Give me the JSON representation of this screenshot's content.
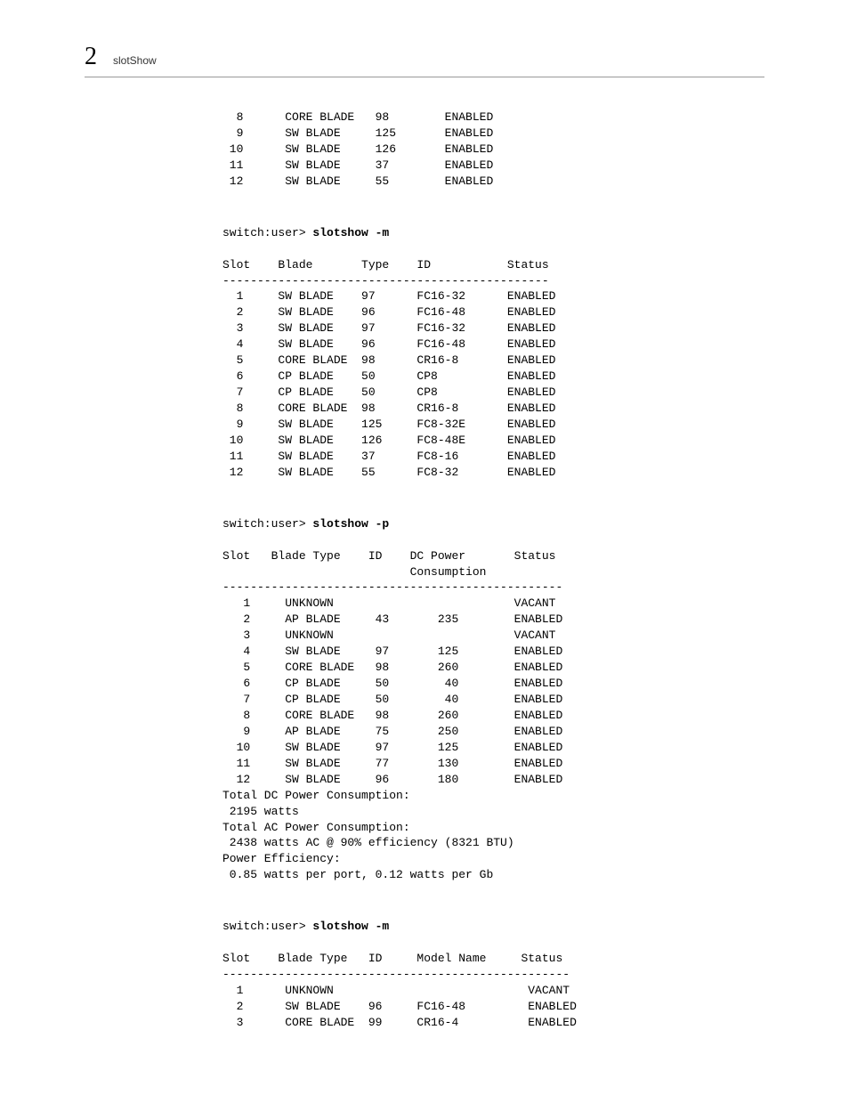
{
  "header": {
    "chapter_number": "2",
    "chapter_title": "slotShow"
  },
  "block1": {
    "lines": [
      "  8      CORE BLADE   98        ENABLED",
      "  9      SW BLADE     125       ENABLED",
      " 10      SW BLADE     126       ENABLED",
      " 11      SW BLADE     37        ENABLED",
      " 12      SW BLADE     55        ENABLED"
    ]
  },
  "block2": {
    "prompt": "switch:user> ",
    "command": "slotshow -m",
    "lines": [
      "",
      "Slot    Blade       Type    ID           Status",
      "-----------------------------------------------",
      "  1     SW BLADE    97      FC16-32      ENABLED",
      "  2     SW BLADE    96      FC16-48      ENABLED",
      "  3     SW BLADE    97      FC16-32      ENABLED",
      "  4     SW BLADE    96      FC16-48      ENABLED",
      "  5     CORE BLADE  98      CR16-8       ENABLED",
      "  6     CP BLADE    50      CP8          ENABLED",
      "  7     CP BLADE    50      CP8          ENABLED",
      "  8     CORE BLADE  98      CR16-8       ENABLED",
      "  9     SW BLADE    125     FC8-32E      ENABLED",
      " 10     SW BLADE    126     FC8-48E      ENABLED",
      " 11     SW BLADE    37      FC8-16       ENABLED",
      " 12     SW BLADE    55      FC8-32       ENABLED"
    ]
  },
  "block3": {
    "prompt": "switch:user> ",
    "command": "slotshow -p",
    "lines": [
      "",
      "Slot   Blade Type    ID    DC Power       Status",
      "                           Consumption",
      "-------------------------------------------------",
      "   1     UNKNOWN                          VACANT",
      "   2     AP BLADE     43       235        ENABLED",
      "   3     UNKNOWN                          VACANT",
      "   4     SW BLADE     97       125        ENABLED",
      "   5     CORE BLADE   98       260        ENABLED",
      "   6     CP BLADE     50        40        ENABLED",
      "   7     CP BLADE     50        40        ENABLED",
      "   8     CORE BLADE   98       260        ENABLED",
      "   9     AP BLADE     75       250        ENABLED",
      "  10     SW BLADE     97       125        ENABLED",
      "  11     SW BLADE     77       130        ENABLED",
      "  12     SW BLADE     96       180        ENABLED",
      "Total DC Power Consumption:",
      " 2195 watts",
      "Total AC Power Consumption:",
      " 2438 watts AC @ 90% efficiency (8321 BTU)",
      "Power Efficiency:",
      " 0.85 watts per port, 0.12 watts per Gb"
    ]
  },
  "block4": {
    "prompt": "switch:user> ",
    "command": "slotshow -m",
    "lines": [
      "",
      "Slot    Blade Type   ID     Model Name     Status",
      "--------------------------------------------------",
      "  1      UNKNOWN                            VACANT",
      "  2      SW BLADE    96     FC16-48         ENABLED",
      "  3      CORE BLADE  99     CR16-4          ENABLED"
    ]
  }
}
